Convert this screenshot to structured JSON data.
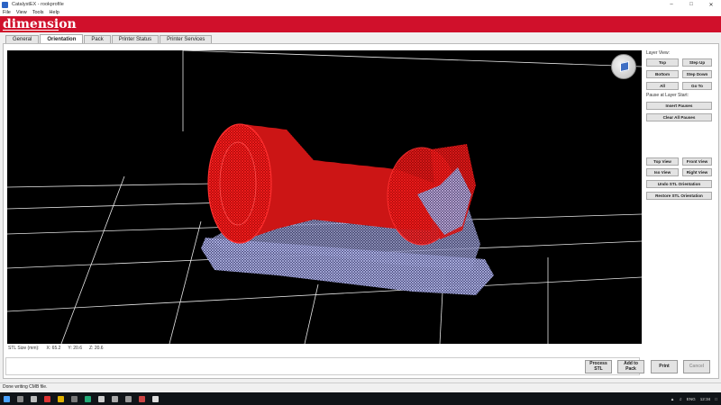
{
  "window": {
    "title": "CatalystEX - rookprofile"
  },
  "menu": [
    "File",
    "View",
    "Tools",
    "Help"
  ],
  "brand": "dimension",
  "tabs": [
    {
      "label": "General",
      "active": false
    },
    {
      "label": "Orientation",
      "active": true
    },
    {
      "label": "Pack",
      "active": false
    },
    {
      "label": "Printer Status",
      "active": false
    },
    {
      "label": "Printer Services",
      "active": false
    }
  ],
  "side": {
    "layer_view_label": "Layer View:",
    "top": "Top",
    "step_up": "Step Up",
    "bottom": "Bottom",
    "step_down": "Step Down",
    "all": "All",
    "go_to": "Go To",
    "pause_label": "Pause at Layer Start:",
    "insert_pauses": "Insert Pauses",
    "clear_all_pauses": "Clear All Pauses",
    "top_view": "Top View",
    "front_view": "Front View",
    "iso_view": "Iso View",
    "right_view": "Right View",
    "undo_stl": "Undo STL Orientation",
    "restore_stl": "Restore STL Orientation"
  },
  "stl": {
    "label": "STL Size (mm):",
    "x": "X: 65.2",
    "y": "Y: 20.6",
    "z": "Z: 20.6"
  },
  "actions": {
    "process_stl": "Process STL",
    "add_to_pack": "Add to Pack",
    "print": "Print",
    "cancel": "Cancel"
  },
  "status": "Done writing CMB file.",
  "tray": {
    "lang": "ENG",
    "time": "12:34"
  },
  "colors": {
    "brand_red": "#d0102b",
    "model_red": "#ff1a1a",
    "support_blue": "#b8bcf0"
  }
}
